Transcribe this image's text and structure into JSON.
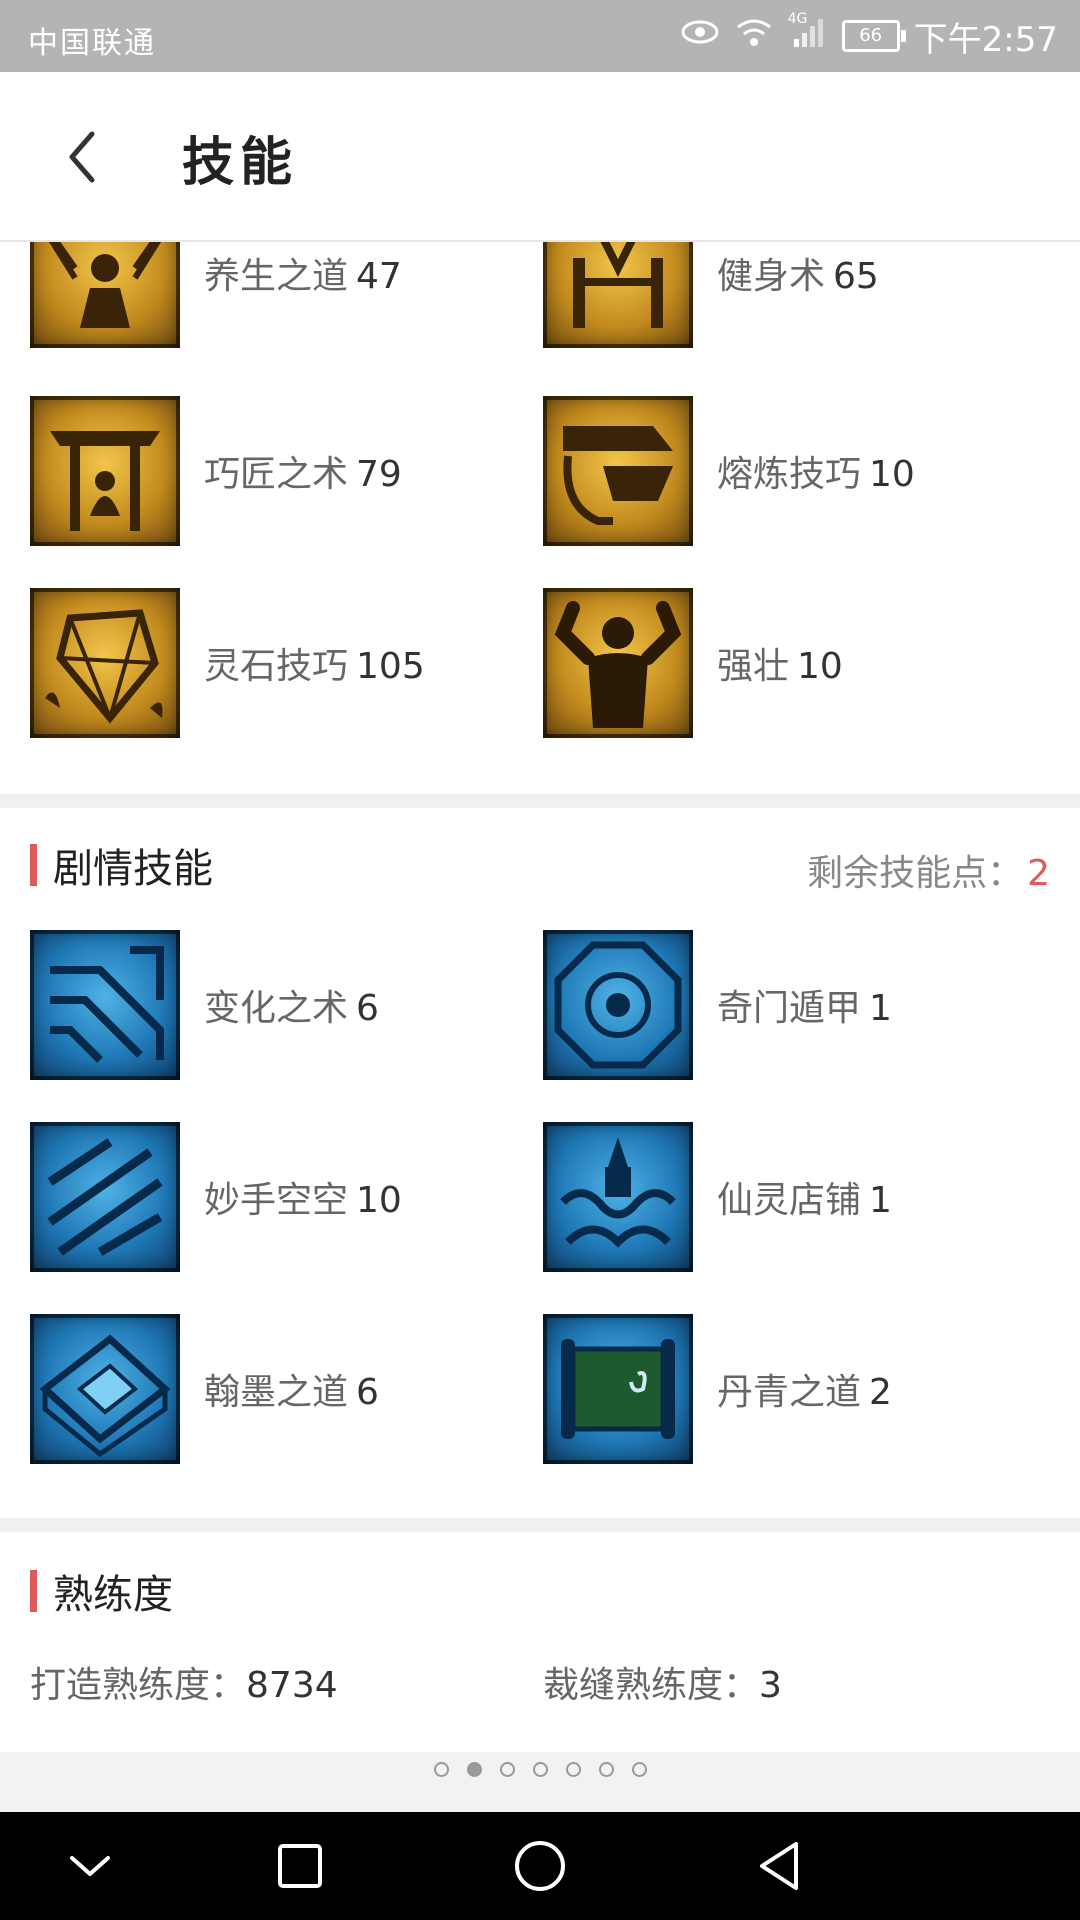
{
  "status_bar": {
    "carrier": "中国联通",
    "network": "4G",
    "battery": "66",
    "time": "下午2:57"
  },
  "header": {
    "title": "技能"
  },
  "life_skills": [
    {
      "name": "养生之道",
      "level": "47",
      "icon": "meditation-icon"
    },
    {
      "name": "健身术",
      "level": "65",
      "icon": "fitness-icon"
    },
    {
      "name": "巧匠之术",
      "level": "79",
      "icon": "craftsman-icon"
    },
    {
      "name": "熔炼技巧",
      "level": "10",
      "icon": "smelting-icon"
    },
    {
      "name": "灵石技巧",
      "level": "105",
      "icon": "spirit-stone-icon"
    },
    {
      "name": "强壮",
      "level": "10",
      "icon": "strength-icon"
    }
  ],
  "story_skills": {
    "title": "剧情技能",
    "remaining_label": "剩余技能点：",
    "remaining_value": "2",
    "items": [
      {
        "name": "变化之术",
        "level": "6",
        "icon": "transform-icon"
      },
      {
        "name": "奇门遁甲",
        "level": "1",
        "icon": "qimen-icon"
      },
      {
        "name": "妙手空空",
        "level": "10",
        "icon": "thief-icon"
      },
      {
        "name": "仙灵店铺",
        "level": "1",
        "icon": "shop-icon"
      },
      {
        "name": "翰墨之道",
        "level": "6",
        "icon": "calligraphy-icon"
      },
      {
        "name": "丹青之道",
        "level": "2",
        "icon": "painting-icon"
      }
    ]
  },
  "proficiency": {
    "title": "熟练度",
    "forge_label": "打造熟练度：",
    "forge_value": "8734",
    "tailor_label": "裁缝熟练度：",
    "tailor_value": "3"
  },
  "pager": {
    "total": 7,
    "active_index": 1
  },
  "colors": {
    "accent": "#e05a5a",
    "gold_icon": "#c28a1e",
    "blue_icon": "#1f78b6"
  }
}
